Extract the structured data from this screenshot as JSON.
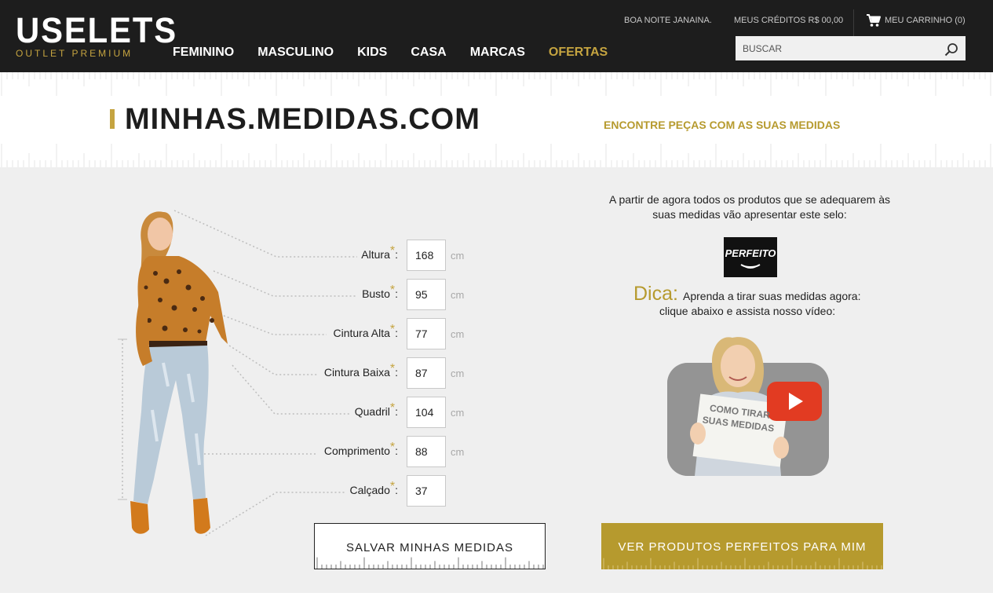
{
  "header": {
    "logo_main": "USELETS",
    "logo_sub": "OUTLET PREMIUM",
    "greeting": "BOA NOITE JANAINA.",
    "credits": "MEUS CRÉDITOS R$ 00,00",
    "cart": "MEU CARRINHO (0)",
    "search_placeholder": "BUSCAR",
    "nav": [
      "FEMININO",
      "MASCULINO",
      "KIDS",
      "CASA",
      "MARCAS",
      "OFERTAS"
    ]
  },
  "hero": {
    "title": "MINHAS.MEDIDAS.COM",
    "subtitle": "ENCONTRE PEÇAS COM AS SUAS MEDIDAS"
  },
  "form": {
    "fields": [
      {
        "label": "Altura",
        "value": "168",
        "unit": "cm"
      },
      {
        "label": "Busto",
        "value": "95",
        "unit": "cm"
      },
      {
        "label": "Cintura Alta",
        "value": "77",
        "unit": "cm"
      },
      {
        "label": "Cintura Baixa",
        "value": "87",
        "unit": "cm"
      },
      {
        "label": "Quadril",
        "value": "104",
        "unit": "cm"
      },
      {
        "label": "Comprimento",
        "value": "88",
        "unit": "cm"
      },
      {
        "label": "Calçado",
        "value": "37",
        "unit": ""
      }
    ],
    "star": "*",
    "save_label": "SALVAR MINHAS MEDIDAS"
  },
  "info": {
    "text": "A partir de agora todos os produtos que se adequarem às suas medidas vão apresentar este selo:",
    "seal": "PERFEITO",
    "tip_word": "Dica:",
    "tip_line1": "Aprenda a tirar suas medidas agora:",
    "tip_line2": "clique abaixo e assista nosso vídeo:",
    "video_caption": "COMO TIRAR SUAS MEDIDAS",
    "see_label": "VER PRODUTOS PERFEITOS PARA MIM"
  },
  "colors": {
    "header_bg": "#1d1d1d",
    "accent_gold": "#c5a440",
    "button_gold": "#b69a2e",
    "panel_bg": "#efefef",
    "video_red": "#e23b22"
  }
}
